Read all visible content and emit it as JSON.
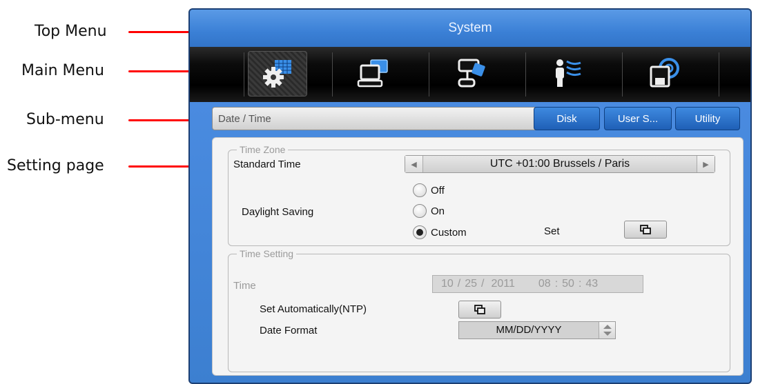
{
  "annotations": {
    "top_menu": "Top Menu",
    "main_menu": "Main Menu",
    "sub_menu": "Sub-menu",
    "setting_page": "Setting page",
    "line_color": "#ff0000"
  },
  "window": {
    "title": "System"
  },
  "main_menu": {
    "items": [
      {
        "icon": "system-settings-icon",
        "active": true
      },
      {
        "icon": "device-monitor-icon",
        "active": false
      },
      {
        "icon": "camera-device-icon",
        "active": false
      },
      {
        "icon": "user-network-icon",
        "active": false
      },
      {
        "icon": "disk-save-icon",
        "active": false
      }
    ]
  },
  "sub_menu": {
    "tabs": [
      {
        "label": "Date / Time",
        "active": true
      },
      {
        "label": "Disk",
        "active": false
      },
      {
        "label": "User S...",
        "active": false
      },
      {
        "label": "Utility",
        "active": false
      }
    ]
  },
  "time_zone": {
    "legend": "Time Zone",
    "standard_time_label": "Standard Time",
    "standard_time_value": "UTC +01:00 Brussels / Paris",
    "daylight_saving_label": "Daylight Saving",
    "options": [
      "Off",
      "On",
      "Custom"
    ],
    "selected": "Custom",
    "set_label": "Set"
  },
  "time_setting": {
    "legend": "Time Setting",
    "time_label": "Time",
    "month": "10",
    "day": "25",
    "year": "2011",
    "hour": "08",
    "minute": "50",
    "second": "43",
    "date_sep": "/",
    "time_sep": ":",
    "ntp_label": "Set Automatically(NTP)",
    "date_format_label": "Date Format",
    "date_format_value": "MM/DD/YYYY"
  },
  "colors": {
    "window_blue": "#3c7fd0",
    "menu_black": "#000000",
    "page_bg": "#f4f4f4"
  }
}
